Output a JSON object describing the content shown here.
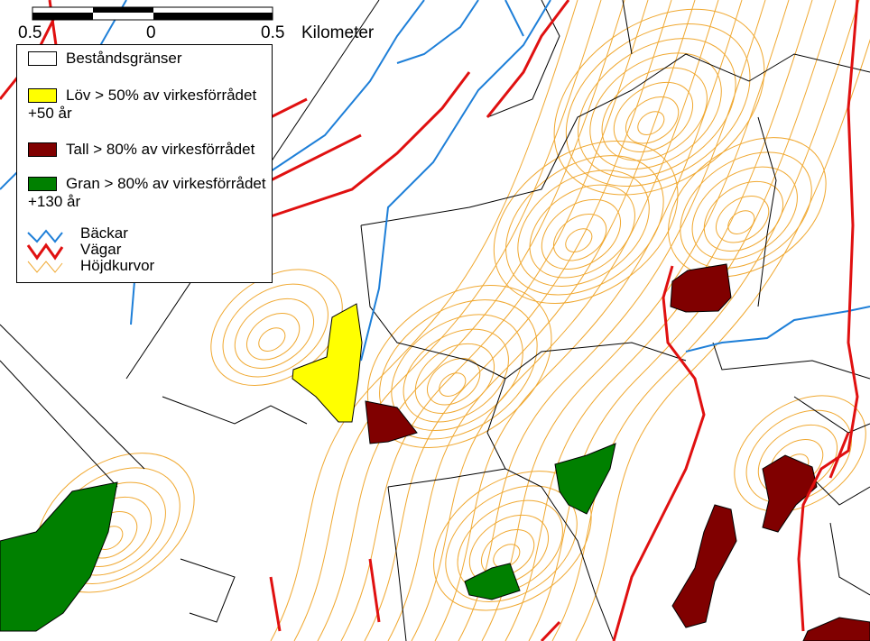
{
  "scale_bar": {
    "left_label": "0.5",
    "center_label": "0",
    "right_label": "0.5",
    "unit": "Kilometer"
  },
  "legend": {
    "items": [
      {
        "label": "Beståndsgränser",
        "color": "#ffffff"
      },
      {
        "label": "Löv  > 50% av virkesförrådet",
        "sub": "+50 år",
        "color": "#ffff00"
      },
      {
        "label": "Tall  > 80% av virkesförrådet",
        "color": "#800000"
      },
      {
        "label": "Gran  > 80% av virkesförrådet",
        "sub": "+130 år",
        "color": "#008000"
      }
    ],
    "lines": [
      {
        "label": "Bäckar",
        "color": "#1e7fd8"
      },
      {
        "label": "Vägar",
        "color": "#e01010"
      },
      {
        "label": "Höjdkurvor",
        "color": "#f0a830"
      }
    ]
  }
}
